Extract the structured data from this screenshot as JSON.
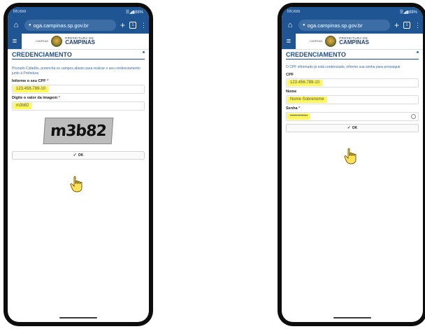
{
  "phones": [
    {
      "status": {
        "time": "hh:mm",
        "icons": "☰◢▮88%"
      },
      "browser": {
        "url": "oga.campinas.sp.gov.br",
        "tab_count": "1"
      },
      "site": {
        "logo_small": "PREFEITURA DE",
        "logo_big": "CAMPINAS",
        "logo_sub": "CAMPINAS"
      },
      "page_title": "CREDENCIAMENTO",
      "intro": "Prezado Cidadão, preencha os campos abaixo para realizar o seu credenciamento junto à Prefeitura",
      "fields": [
        {
          "label": "Informe o seu CPF",
          "value": "123.456.789-10"
        },
        {
          "label": "Digite o valor da imagem",
          "value": "m3b82"
        }
      ],
      "captcha_text": "m3b82",
      "ok_label": "OK"
    },
    {
      "status": {
        "time": "hh:mm",
        "icons": "☰◢▮88%"
      },
      "browser": {
        "url": "oga.campinas.sp.gov.br",
        "tab_count": "1"
      },
      "site": {
        "logo_small": "PREFEITURA DE",
        "logo_big": "CAMPINAS",
        "logo_sub": "CAMPINAS"
      },
      "page_title": "CREDENCIAMENTO",
      "intro": "O CPF informado já está credenciado, informe sua senha para prosseguir",
      "fields": [
        {
          "label": "CPF",
          "value": "123.456.789-10"
        },
        {
          "label": "Nome",
          "value": "Nome Sobrenome"
        },
        {
          "label": "Senha",
          "value": "••••••••••••"
        }
      ],
      "ok_label": "OK"
    }
  ],
  "colors": {
    "brand_blue": "#1f5592",
    "highlight": "#fff65a",
    "title_blue": "#1f4f8a"
  },
  "icons": [
    "home-icon",
    "lock-icon",
    "plus-icon",
    "tabs-icon",
    "menu-dots-icon",
    "hamburger-icon",
    "check-icon",
    "hand-cursor-icon",
    "eye-icon"
  ]
}
